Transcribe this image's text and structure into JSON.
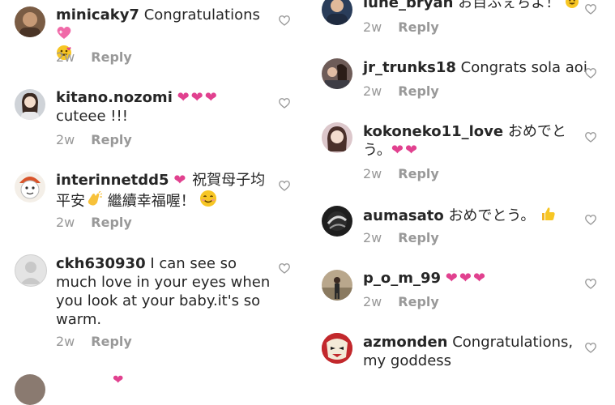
{
  "left_comments": [
    {
      "username": "minicaky7",
      "text": "Congratulations",
      "text_after": "",
      "time": "2w",
      "reply": "Reply"
    },
    {
      "username": "kitano.nozomi",
      "text": "",
      "text_after": "cuteee !!!",
      "time": "2w",
      "reply": "Reply"
    },
    {
      "username": "interinnetdd5",
      "text": "祝賀母子均",
      "text_after": "平安",
      "text_after2": "繼續幸福喔！",
      "time": "2w",
      "reply": "Reply"
    },
    {
      "username": "ckh630930",
      "text": "I can see so",
      "text_after": "much love in your eyes when",
      "text_after2": "you look at your baby.it's so",
      "text_after3": "warm.",
      "time": "2w",
      "reply": "Reply"
    }
  ],
  "right_comments": [
    {
      "username": "lune_bryan",
      "text": "お目ふぇちよ！",
      "time": "2w",
      "reply": "Reply"
    },
    {
      "username": "jr_trunks18",
      "text": "Congrats sola aoi",
      "time": "2w",
      "reply": "Reply"
    },
    {
      "username": "kokoneko11_love",
      "text": "おめでと",
      "text_after": "う。",
      "time": "2w",
      "reply": "Reply"
    },
    {
      "username": "aumasato",
      "text": "おめでとう。",
      "time": "2w",
      "reply": "Reply"
    },
    {
      "username": "p_o_m_99",
      "text": "",
      "time": "2w",
      "reply": "Reply"
    },
    {
      "username": "azmonden",
      "text": "Congratulations,",
      "text_after": "my goddess",
      "time": "",
      "reply": ""
    }
  ],
  "colors": {
    "heart": "#e1418f",
    "meta": "#999999",
    "text": "#262626"
  },
  "icons": [
    "heart-outline-icon",
    "pink-heart-icon",
    "clapping-hands-icon",
    "smiling-face-icon",
    "thumbs-up-icon",
    "sparkling-heart-icon",
    "grinning-face-icon"
  ]
}
